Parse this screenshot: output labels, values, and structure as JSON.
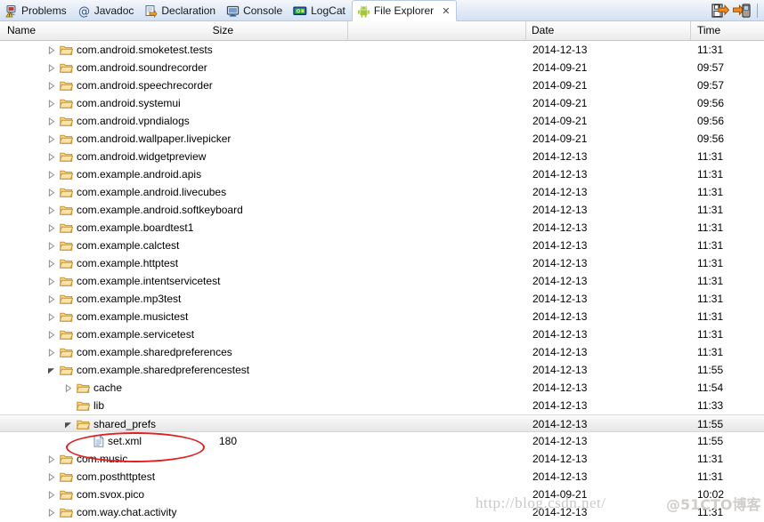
{
  "tabs": [
    {
      "label": "Problems",
      "icon": "problems-icon",
      "active": false
    },
    {
      "label": "Javadoc",
      "icon": "javadoc-icon",
      "active": false
    },
    {
      "label": "Declaration",
      "icon": "declaration-icon",
      "active": false
    },
    {
      "label": "Console",
      "icon": "console-icon",
      "active": false
    },
    {
      "label": "LogCat",
      "icon": "logcat-icon",
      "active": false
    },
    {
      "label": "File Explorer",
      "icon": "android-icon",
      "active": true,
      "close": "✕"
    }
  ],
  "toolbar": {
    "pull_label": "pull-file-from-device-icon",
    "push_label": "push-file-onto-device-icon"
  },
  "columns": {
    "name": "Name",
    "size": "Size",
    "date": "Date",
    "time": "Time"
  },
  "rows": [
    {
      "name": "com.android.smoketest.tests",
      "indent": 0,
      "type": "folder",
      "arrow": "collapsed",
      "size": "",
      "date": "2014-12-13",
      "time": "11:31",
      "selected": false
    },
    {
      "name": "com.android.soundrecorder",
      "indent": 0,
      "type": "folder",
      "arrow": "collapsed",
      "size": "",
      "date": "2014-09-21",
      "time": "09:57",
      "selected": false
    },
    {
      "name": "com.android.speechrecorder",
      "indent": 0,
      "type": "folder",
      "arrow": "collapsed",
      "size": "",
      "date": "2014-09-21",
      "time": "09:57",
      "selected": false
    },
    {
      "name": "com.android.systemui",
      "indent": 0,
      "type": "folder",
      "arrow": "collapsed",
      "size": "",
      "date": "2014-09-21",
      "time": "09:56",
      "selected": false
    },
    {
      "name": "com.android.vpndialogs",
      "indent": 0,
      "type": "folder",
      "arrow": "collapsed",
      "size": "",
      "date": "2014-09-21",
      "time": "09:56",
      "selected": false
    },
    {
      "name": "com.android.wallpaper.livepicker",
      "indent": 0,
      "type": "folder",
      "arrow": "collapsed",
      "size": "",
      "date": "2014-09-21",
      "time": "09:56",
      "selected": false
    },
    {
      "name": "com.android.widgetpreview",
      "indent": 0,
      "type": "folder",
      "arrow": "collapsed",
      "size": "",
      "date": "2014-12-13",
      "time": "11:31",
      "selected": false
    },
    {
      "name": "com.example.android.apis",
      "indent": 0,
      "type": "folder",
      "arrow": "collapsed",
      "size": "",
      "date": "2014-12-13",
      "time": "11:31",
      "selected": false
    },
    {
      "name": "com.example.android.livecubes",
      "indent": 0,
      "type": "folder",
      "arrow": "collapsed",
      "size": "",
      "date": "2014-12-13",
      "time": "11:31",
      "selected": false
    },
    {
      "name": "com.example.android.softkeyboard",
      "indent": 0,
      "type": "folder",
      "arrow": "collapsed",
      "size": "",
      "date": "2014-12-13",
      "time": "11:31",
      "selected": false
    },
    {
      "name": "com.example.boardtest1",
      "indent": 0,
      "type": "folder",
      "arrow": "collapsed",
      "size": "",
      "date": "2014-12-13",
      "time": "11:31",
      "selected": false
    },
    {
      "name": "com.example.calctest",
      "indent": 0,
      "type": "folder",
      "arrow": "collapsed",
      "size": "",
      "date": "2014-12-13",
      "time": "11:31",
      "selected": false
    },
    {
      "name": "com.example.httptest",
      "indent": 0,
      "type": "folder",
      "arrow": "collapsed",
      "size": "",
      "date": "2014-12-13",
      "time": "11:31",
      "selected": false
    },
    {
      "name": "com.example.intentservicetest",
      "indent": 0,
      "type": "folder",
      "arrow": "collapsed",
      "size": "",
      "date": "2014-12-13",
      "time": "11:31",
      "selected": false
    },
    {
      "name": "com.example.mp3test",
      "indent": 0,
      "type": "folder",
      "arrow": "collapsed",
      "size": "",
      "date": "2014-12-13",
      "time": "11:31",
      "selected": false
    },
    {
      "name": "com.example.musictest",
      "indent": 0,
      "type": "folder",
      "arrow": "collapsed",
      "size": "",
      "date": "2014-12-13",
      "time": "11:31",
      "selected": false
    },
    {
      "name": "com.example.servicetest",
      "indent": 0,
      "type": "folder",
      "arrow": "collapsed",
      "size": "",
      "date": "2014-12-13",
      "time": "11:31",
      "selected": false
    },
    {
      "name": "com.example.sharedpreferences",
      "indent": 0,
      "type": "folder",
      "arrow": "collapsed",
      "size": "",
      "date": "2014-12-13",
      "time": "11:31",
      "selected": false
    },
    {
      "name": "com.example.sharedpreferencestest",
      "indent": 0,
      "type": "folder",
      "arrow": "expanded",
      "size": "",
      "date": "2014-12-13",
      "time": "11:55",
      "selected": false
    },
    {
      "name": "cache",
      "indent": 1,
      "type": "folder",
      "arrow": "collapsed",
      "size": "",
      "date": "2014-12-13",
      "time": "11:54",
      "selected": false
    },
    {
      "name": "lib",
      "indent": 1,
      "type": "folder",
      "arrow": "none",
      "size": "",
      "date": "2014-12-13",
      "time": "11:33",
      "selected": false
    },
    {
      "name": "shared_prefs",
      "indent": 1,
      "type": "folder",
      "arrow": "expanded",
      "size": "",
      "date": "2014-12-13",
      "time": "11:55",
      "selected": true
    },
    {
      "name": "set.xml",
      "indent": 2,
      "type": "file",
      "arrow": "none",
      "size": "180",
      "date": "2014-12-13",
      "time": "11:55",
      "selected": false
    },
    {
      "name": "com.music",
      "indent": 0,
      "type": "folder",
      "arrow": "collapsed",
      "size": "",
      "date": "2014-12-13",
      "time": "11:31",
      "selected": false
    },
    {
      "name": "com.posthttptest",
      "indent": 0,
      "type": "folder",
      "arrow": "collapsed",
      "size": "",
      "date": "2014-12-13",
      "time": "11:31",
      "selected": false
    },
    {
      "name": "com.svox.pico",
      "indent": 0,
      "type": "folder",
      "arrow": "collapsed",
      "size": "",
      "date": "2014-09-21",
      "time": "10:02",
      "selected": false
    },
    {
      "name": "com.way.chat.activity",
      "indent": 0,
      "type": "folder",
      "arrow": "collapsed",
      "size": "",
      "date": "2014-12-13",
      "time": "11:31",
      "selected": false
    }
  ],
  "annotation": {
    "shape": "ellipse",
    "color": "#e02020",
    "target": "set.xml"
  },
  "watermark": {
    "url": "http://blog.csdn.net/",
    "handle": "@51CTO博客"
  }
}
